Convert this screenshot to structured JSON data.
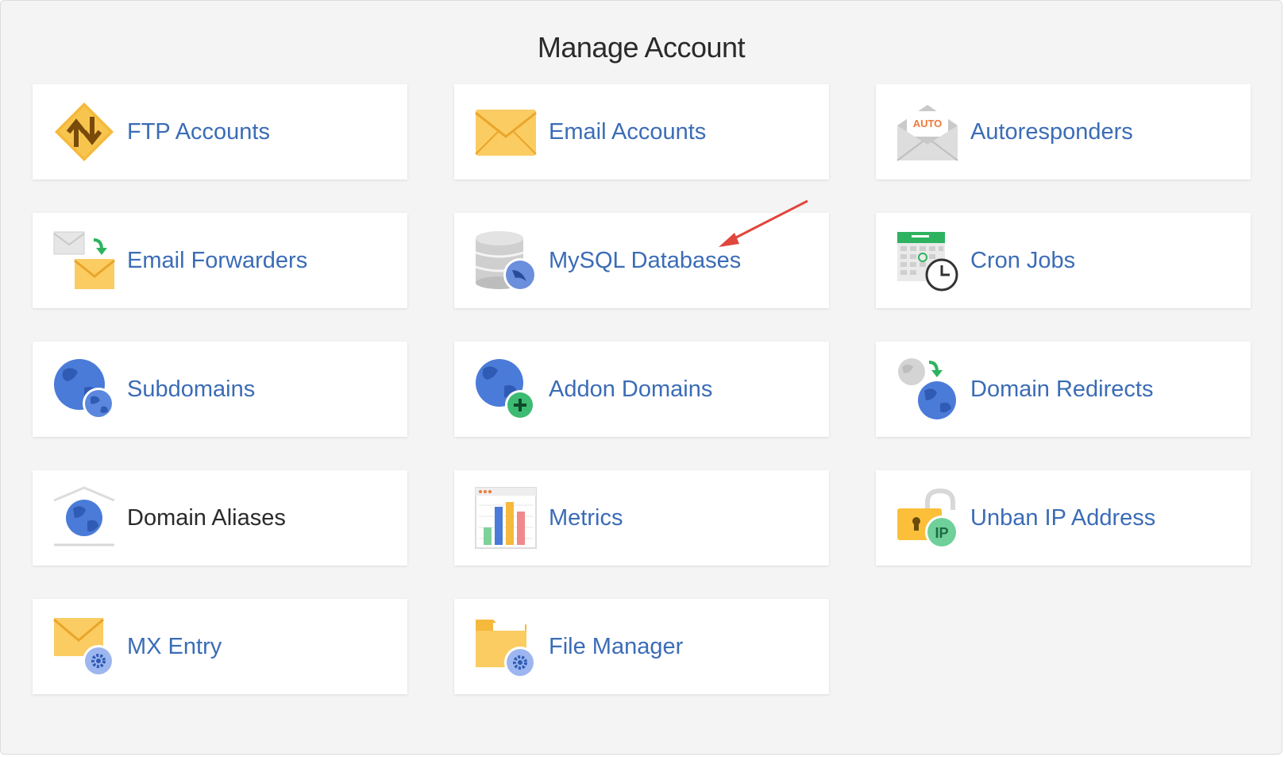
{
  "page": {
    "title": "Manage Account"
  },
  "tiles": [
    {
      "label": "FTP Accounts",
      "icon": "ftp-icon"
    },
    {
      "label": "Email Accounts",
      "icon": "email-icon"
    },
    {
      "label": "Autoresponders",
      "icon": "autoresponder-icon",
      "badge": "AUTO"
    },
    {
      "label": "Email Forwarders",
      "icon": "email-forwarder-icon"
    },
    {
      "label": "MySQL Databases",
      "icon": "database-icon"
    },
    {
      "label": "Cron Jobs",
      "icon": "cron-calendar-clock-icon"
    },
    {
      "label": "Subdomains",
      "icon": "subdomain-globe-icon"
    },
    {
      "label": "Addon Domains",
      "icon": "addon-domain-globe-icon"
    },
    {
      "label": "Domain Redirects",
      "icon": "domain-redirect-globe-icon"
    },
    {
      "label": "Domain Aliases",
      "icon": "domain-alias-icon"
    },
    {
      "label": "Metrics",
      "icon": "metrics-chart-icon"
    },
    {
      "label": "Unban IP Address",
      "icon": "unban-ip-lock-icon",
      "badge": "IP"
    },
    {
      "label": "MX Entry",
      "icon": "mx-entry-icon"
    },
    {
      "label": "File Manager",
      "icon": "file-manager-folder-icon"
    }
  ],
  "colors": {
    "label": "#3b6cb6",
    "background": "#f4f4f4",
    "annotation_arrow": "#e0463c"
  }
}
